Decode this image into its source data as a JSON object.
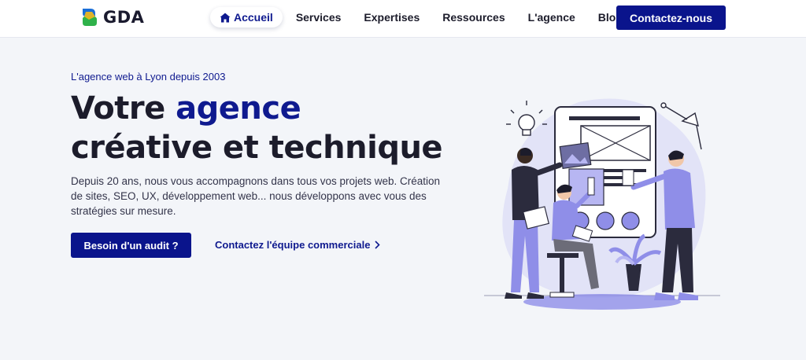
{
  "brand": {
    "name": "GDA"
  },
  "nav": {
    "items": [
      {
        "label": "Accueil"
      },
      {
        "label": "Services"
      },
      {
        "label": "Expertises"
      },
      {
        "label": "Ressources"
      },
      {
        "label": "L'agence"
      },
      {
        "label": "Blog"
      }
    ],
    "cta_label": "Contactez-nous"
  },
  "hero": {
    "kicker": "L'agence web à Lyon depuis 2003",
    "title_part1": "Votre ",
    "title_highlight": "agence",
    "title_line2": "créative et technique",
    "description": "Depuis 20 ans, nous vous accompagnons dans tous vos projets web. Création de sites, SEO, UX, développement web... nous développons avec vous des stratégies sur mesure.",
    "primary_button": "Besoin d'un audit ?",
    "secondary_link": "Contactez l'équipe commerciale"
  },
  "colors": {
    "brand_navy": "#0a148c",
    "accent_purple": "#8f8ee8",
    "background": "#f3f5f9"
  }
}
